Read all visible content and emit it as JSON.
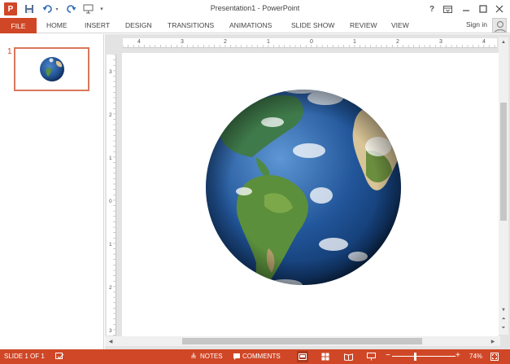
{
  "titlebar": {
    "app_icon": "P",
    "title": "Presentation1 - PowerPoint",
    "icons": [
      "save-icon",
      "undo-icon",
      "redo-icon",
      "present-icon",
      "customize-qat-icon",
      "help-icon",
      "ribbon-display-icon",
      "minimize-icon",
      "maximize-icon",
      "close-icon"
    ],
    "help": "?"
  },
  "ribbon": {
    "file_tab": "FILE",
    "tabs": [
      "HOME",
      "INSERT",
      "DESIGN",
      "TRANSITIONS",
      "ANIMATIONS",
      "SLIDE SHOW",
      "REVIEW",
      "VIEW"
    ],
    "sign_in": "Sign in"
  },
  "thumbnails": {
    "slide_number": "1"
  },
  "rulers": {
    "horizontal_labels": [
      "4",
      "3",
      "2",
      "1",
      "0",
      "1",
      "2",
      "3",
      "4"
    ],
    "vertical_labels": [
      "3",
      "2",
      "1",
      "0",
      "1",
      "2",
      "3"
    ]
  },
  "slide": {
    "image": "earth-globe"
  },
  "statusbar": {
    "slide_info": "SLIDE 1 OF 1",
    "notes": "NOTES",
    "comments": "COMMENTS",
    "zoom_minus": "−",
    "zoom_plus": "+",
    "zoom_level": "74%",
    "zoom_value": 74
  },
  "colors": {
    "accent": "#d04727",
    "ocean": "#1f4f8f",
    "land_green": "#5b8f3c",
    "desert": "#d8c496"
  }
}
